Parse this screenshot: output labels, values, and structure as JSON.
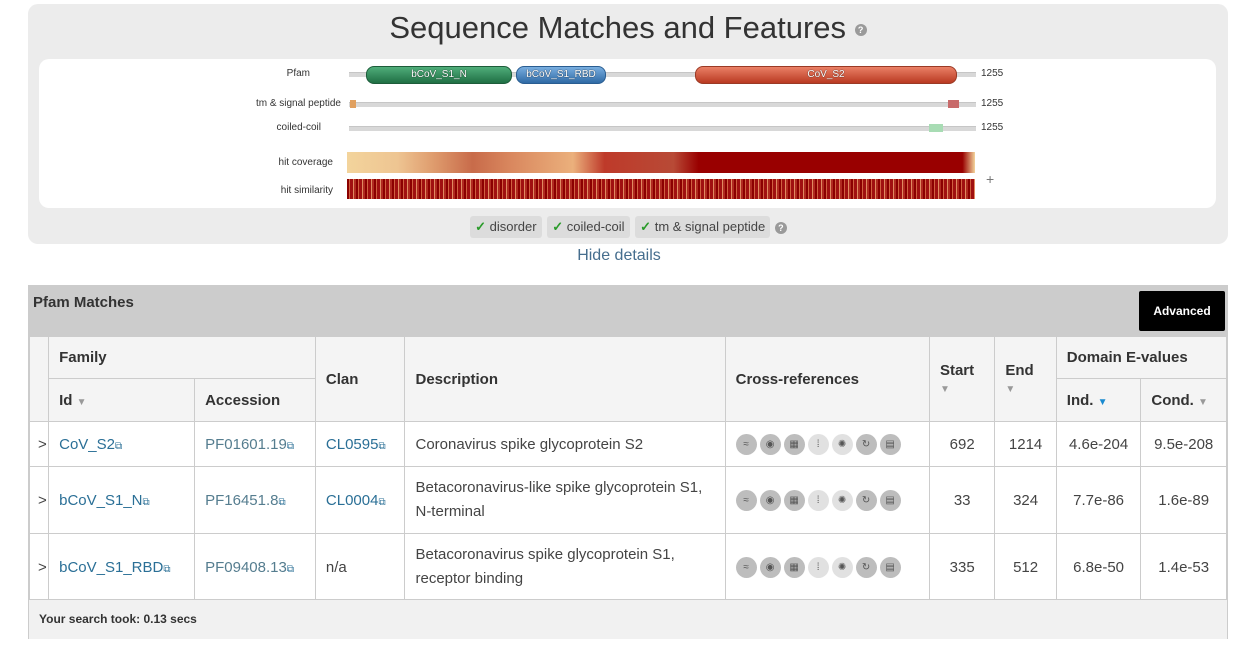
{
  "features": {
    "title": "Sequence Matches and Features",
    "help": "?",
    "tracks": [
      {
        "label": "Pfam",
        "end": "1255"
      },
      {
        "label": "tm & signal peptide",
        "end": "1255"
      },
      {
        "label": "coiled-coil",
        "end": "1255"
      }
    ],
    "domains": [
      "bCoV_S1_N",
      "bCoV_S1_RBD",
      "CoV_S2"
    ],
    "heat_labels": [
      "hit coverage",
      "hit similarity"
    ],
    "plus": "+",
    "toggles": [
      "disorder",
      "coiled-coil",
      "tm & signal peptide"
    ],
    "check": "✓",
    "hide_details": "Hide details"
  },
  "pfam": {
    "title": "Pfam Matches",
    "advanced": "Advanced",
    "headers": {
      "family": "Family",
      "id": "Id",
      "accession": "Accession",
      "clan": "Clan",
      "description": "Description",
      "xrefs": "Cross-references",
      "start": "Start",
      "end": "End",
      "evalues": "Domain E-values",
      "ind": "Ind.",
      "cond": "Cond."
    },
    "rows": [
      {
        "expand": ">",
        "id": "CoV_S2",
        "accession": "PF01601.19",
        "clan": "CL0595",
        "description": "Coronavirus spike glycoprotein S2",
        "start": "692",
        "end": "1214",
        "ind": "4.6e-204",
        "cond": "9.5e-208"
      },
      {
        "expand": ">",
        "id": "bCoV_S1_N",
        "accession": "PF16451.8",
        "clan": "CL0004",
        "description": "Betacoronavirus-like spike glycoprotein S1, N-terminal",
        "start": "33",
        "end": "324",
        "ind": "7.7e-86",
        "cond": "1.6e-89"
      },
      {
        "expand": ">",
        "id": "bCoV_S1_RBD",
        "accession": "PF09408.13",
        "clan": "n/a",
        "description": "Betacoronavirus spike glycoprotein S1, receptor binding",
        "start": "335",
        "end": "512",
        "ind": "6.8e-50",
        "cond": "1.4e-53"
      }
    ],
    "footer": "Your search took: 0.13 secs"
  },
  "colors": {
    "domain_green": "#2e8b57",
    "domain_blue": "#4a88c8",
    "domain_red": "#d2553a",
    "link": "#2a6f96"
  },
  "icons": [
    "sequence-icon",
    "structure-icon",
    "grid-icon",
    "tree-icon",
    "virus-icon",
    "cycle-icon",
    "document-icon",
    "external-link-icon",
    "sort-caret-icon"
  ]
}
